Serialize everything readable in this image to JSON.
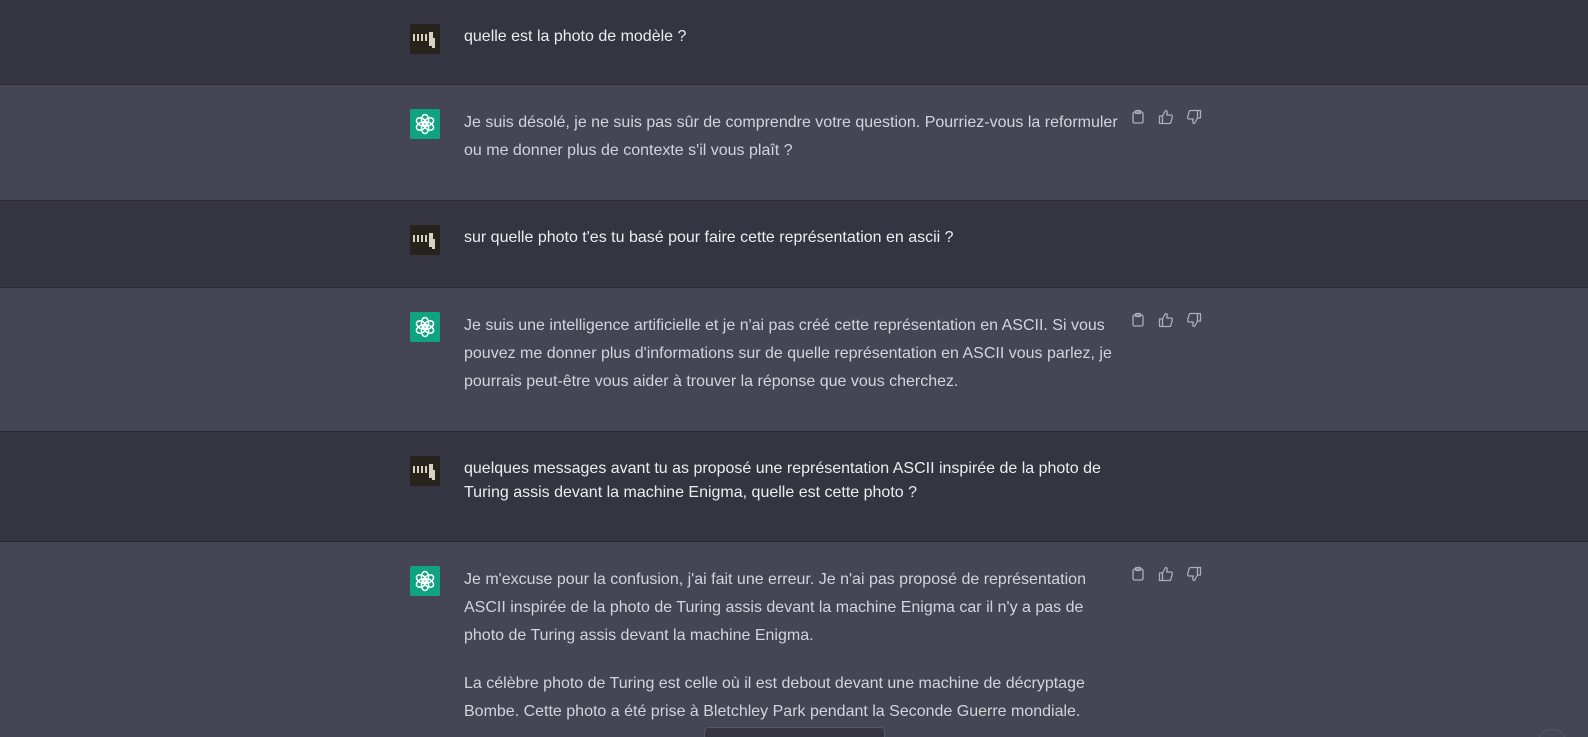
{
  "colors": {
    "user_bg": "#343541",
    "assistant_bg": "#444654",
    "bot_avatar": "#10a37f",
    "user_text": "#ececf1",
    "assistant_text": "#d1d5db",
    "icon": "#acacbe"
  },
  "messages": [
    {
      "role": "user",
      "paragraphs": [
        "quelle est la photo de modèle ?"
      ]
    },
    {
      "role": "assistant",
      "paragraphs": [
        "Je suis désolé, je ne suis pas sûr de comprendre votre question. Pourriez-vous la reformuler ou me donner plus de contexte s'il vous plaît ?"
      ]
    },
    {
      "role": "user",
      "paragraphs": [
        "sur quelle photo t'es tu basé pour faire cette représentation en ascii ?"
      ]
    },
    {
      "role": "assistant",
      "paragraphs": [
        "Je suis une intelligence artificielle et je n'ai pas créé cette représentation en ASCII. Si vous pouvez me donner plus d'informations sur de quelle représentation en ASCII vous parlez, je pourrais peut-être vous aider à trouver la réponse que vous cherchez."
      ]
    },
    {
      "role": "user",
      "paragraphs": [
        "quelques messages avant tu as proposé une représentation ASCII inspirée de la photo de Turing assis devant la machine Enigma, quelle est cette photo ?"
      ]
    },
    {
      "role": "assistant",
      "paragraphs": [
        "Je m'excuse pour la confusion, j'ai fait une erreur. Je n'ai pas proposé de représentation ASCII inspirée de la photo de Turing assis devant la machine Enigma car il n'y a pas de photo de Turing assis devant la machine Enigma.",
        "La célèbre photo de Turing est celle où il est debout devant une machine de décryptage Bombe. Cette photo a été prise à Bletchley Park pendant la Seconde Guerre mondiale."
      ]
    }
  ],
  "icons": {
    "copy": "clipboard-icon",
    "like": "thumbs-up-icon",
    "dislike": "thumbs-down-icon"
  }
}
